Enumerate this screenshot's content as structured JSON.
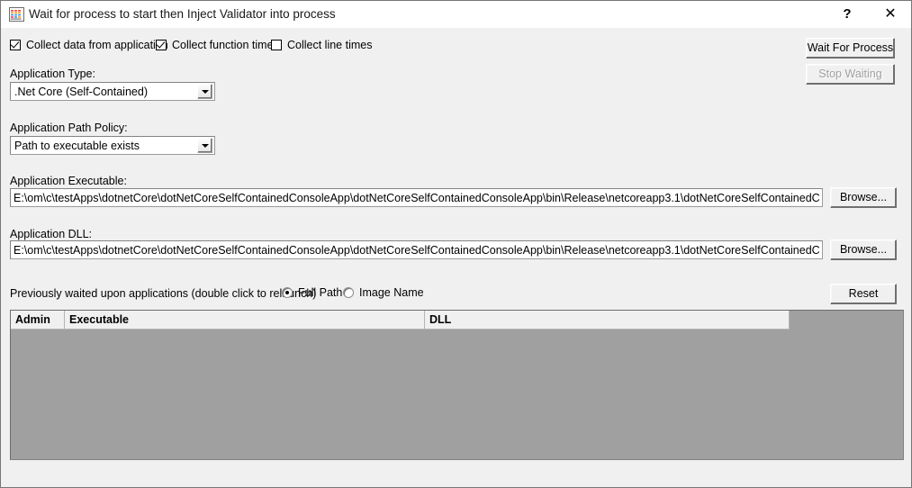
{
  "window": {
    "title": "Wait for process to start then Inject Validator into process",
    "icon": "bar-chart-icon",
    "help_glyph": "?",
    "close_glyph": "✕"
  },
  "options": {
    "checkboxes": [
      {
        "label": "Collect data from application",
        "checked": true
      },
      {
        "label": "Collect function times",
        "checked": true
      },
      {
        "label": "Collect line times",
        "checked": false
      }
    ]
  },
  "actions": {
    "wait_for_process": "Wait For Process",
    "stop_waiting": "Stop Waiting",
    "browse_executable": "Browse...",
    "browse_dll": "Browse...",
    "reset": "Reset"
  },
  "fields": {
    "application_type": {
      "label": "Application Type:",
      "value": ".Net Core (Self-Contained)"
    },
    "application_path_policy": {
      "label": "Application Path Policy:",
      "value": "Path to executable exists"
    },
    "application_executable": {
      "label": "Application Executable:",
      "value": "E:\\om\\c\\testApps\\dotnetCore\\dotNetCoreSelfContainedConsoleApp\\dotNetCoreSelfContainedConsoleApp\\bin\\Release\\netcoreapp3.1\\dotNetCoreSelfContainedConsoleApp.exe"
    },
    "application_dll": {
      "label": "Application DLL:",
      "value": "E:\\om\\c\\testApps\\dotnetCore\\dotNetCoreSelfContainedConsoleApp\\dotNetCoreSelfContainedConsoleApp\\bin\\Release\\netcoreapp3.1\\dotNetCoreSelfContainedConsoleApp.dll"
    }
  },
  "history": {
    "label": "Previously waited upon applications (double click to relaunch)",
    "display_mode": [
      {
        "label": "Full Path",
        "selected": true
      },
      {
        "label": "Image Name",
        "selected": false
      }
    ],
    "columns": [
      "Admin",
      "Executable",
      "DLL"
    ],
    "rows": []
  },
  "colors": {
    "dialog_background": "#f0f0f0",
    "titlebar_background": "#ffffff",
    "list_background": "#a0a0a0",
    "border": "#767676",
    "disabled_text": "#a0a0a0"
  }
}
